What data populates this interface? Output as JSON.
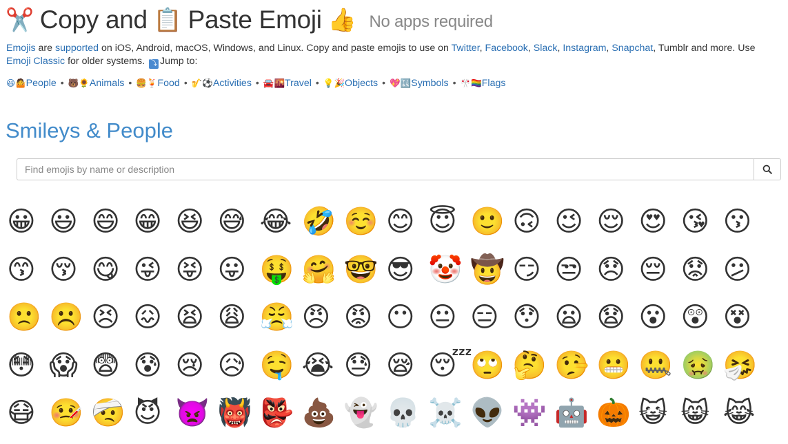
{
  "header": {
    "emoji_left": "✂️",
    "title_part1": "Copy and",
    "emoji_mid": "📋",
    "title_part2": "Paste Emoji",
    "emoji_right": "👍",
    "subtitle": "No apps required"
  },
  "intro": {
    "link_emojis": "Emojis",
    "t1": " are ",
    "link_supported": "supported",
    "t2": " on iOS, Android, macOS, Windows, and Linux. Copy and paste emojis to use on ",
    "link_twitter": "Twitter",
    "c1": ", ",
    "link_facebook": "Facebook",
    "c2": ", ",
    "link_slack": "Slack",
    "c3": ", ",
    "link_instagram": "Instagram",
    "c4": ", ",
    "link_snapchat": "Snapchat",
    "t3": ", Tumblr and more. Use ",
    "link_emoji_classic": "Emoji Classic",
    "t4": " for older systems.",
    "jump_icon": "⤵",
    "jump_to": "Jump to:"
  },
  "categories": [
    {
      "icon": "😃🤷",
      "label": "People"
    },
    {
      "icon": "🐻🌻",
      "label": "Animals"
    },
    {
      "icon": "🍔🍹",
      "label": "Food"
    },
    {
      "icon": "🎷⚽",
      "label": "Activities"
    },
    {
      "icon": "🚘🌇",
      "label": "Travel"
    },
    {
      "icon": "💡🎉",
      "label": "Objects"
    },
    {
      "icon": "💖🔣",
      "label": "Symbols"
    },
    {
      "icon": "🎌🏳️‍🌈",
      "label": "Flags"
    }
  ],
  "separator": "•",
  "section_title": "Smileys & People",
  "search": {
    "placeholder": "Find emojis by name or description",
    "button_icon": "search-icon"
  },
  "emojis": [
    "😀",
    "😃",
    "😄",
    "😁",
    "😆",
    "😅",
    "😂",
    "🤣",
    "☺️",
    "😊",
    "😇",
    "🙂",
    "🙃",
    "😉",
    "😌",
    "😍",
    "😘",
    "😗",
    "😙",
    "😚",
    "😋",
    "😜",
    "😝",
    "😛",
    "🤑",
    "🤗",
    "🤓",
    "😎",
    "🤡",
    "🤠",
    "😏",
    "😒",
    "😞",
    "😔",
    "😟",
    "😕",
    "🙁",
    "☹️",
    "😣",
    "😖",
    "😫",
    "😩",
    "😤",
    "😠",
    "😡",
    "😶",
    "😐",
    "😑",
    "😯",
    "😦",
    "😧",
    "😮",
    "😲",
    "😵",
    "😳",
    "😱",
    "😨",
    "😰",
    "😢",
    "😥",
    "🤤",
    "😭",
    "😓",
    "😪",
    "😴",
    "🙄",
    "🤔",
    "🤥",
    "😬",
    "🤐",
    "🤢",
    "🤧",
    "😷",
    "🤒",
    "🤕",
    "😈",
    "👿",
    "👹",
    "👺",
    "💩",
    "👻",
    "💀",
    "☠️",
    "👽",
    "👾",
    "🤖",
    "🎃",
    "😺",
    "😸",
    "😹"
  ]
}
